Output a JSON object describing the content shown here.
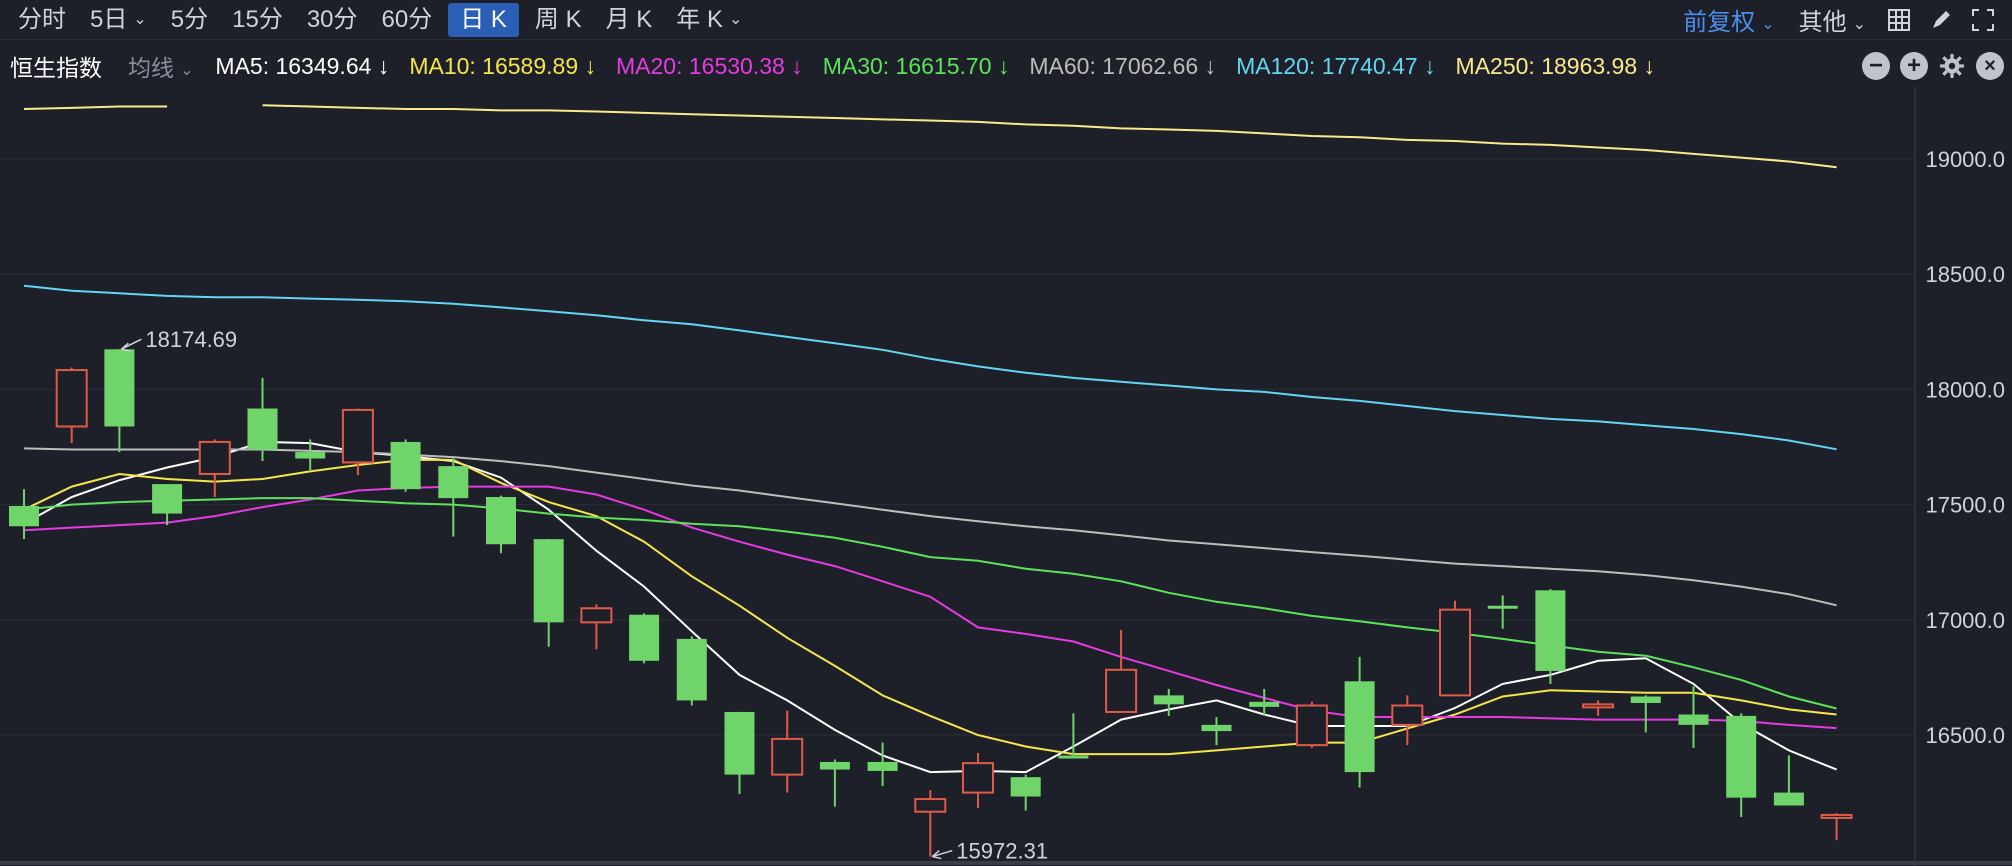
{
  "toolbar": {
    "tabs": [
      {
        "label": "分时",
        "caret": false,
        "active": false
      },
      {
        "label": "5日",
        "caret": true,
        "active": false
      },
      {
        "label": "5分",
        "caret": false,
        "active": false
      },
      {
        "label": "15分",
        "caret": false,
        "active": false
      },
      {
        "label": "30分",
        "caret": false,
        "active": false
      },
      {
        "label": "60分",
        "caret": false,
        "active": false
      },
      {
        "label": "日 K",
        "caret": false,
        "active": true
      },
      {
        "label": "周 K",
        "caret": false,
        "active": false
      },
      {
        "label": "月 K",
        "caret": false,
        "active": false
      },
      {
        "label": "年 K",
        "caret": true,
        "active": false
      }
    ],
    "adjust_label": "前复权",
    "other_label": "其他",
    "icons": [
      "grid-layout-icon",
      "draw-pen-icon",
      "fullscreen-icon"
    ]
  },
  "legend": {
    "index_name": "恒生指数",
    "ma_select": "均线",
    "items": [
      {
        "text": "MA5: 16349.64 ↓",
        "color": "#ffffff"
      },
      {
        "text": "MA10: 16589.89 ↓",
        "color": "#f7e64a"
      },
      {
        "text": "MA20: 16530.38 ↓",
        "color": "#e53be0"
      },
      {
        "text": "MA30: 16615.70 ↓",
        "color": "#5ce35a"
      },
      {
        "text": "MA60: 17062.66 ↓",
        "color": "#bdbdbd"
      },
      {
        "text": "MA120: 17740.47 ↓",
        "color": "#62d6f2"
      },
      {
        "text": "MA250: 18963.98 ↓",
        "color": "#fbea8a"
      }
    ],
    "icons": [
      "zoom-out-icon",
      "zoom-in-icon",
      "settings-icon",
      "close-icon"
    ]
  },
  "chart_data": {
    "type": "candlestick",
    "y_ticks": [
      "19000.0",
      "18500.0",
      "18000.0",
      "17500.0",
      "17000.0",
      "16500.0"
    ],
    "y_tick_values": [
      19000,
      18500,
      18000,
      17500,
      17000,
      16500
    ],
    "ylim": [
      15900,
      19250
    ],
    "up_color": "#e05a4a",
    "down_color": "#6fd46a",
    "candles": [
      {
        "o": 17406,
        "h": 17567,
        "c": 17494,
        "l": 17350,
        "dir": "down"
      },
      {
        "o": 17839,
        "h": 18095,
        "c": 18084,
        "l": 17767,
        "dir": "up"
      },
      {
        "o": 17839,
        "h": 18174.69,
        "c": 18174,
        "l": 17728,
        "dir": "down"
      },
      {
        "o": 17461,
        "h": 17578,
        "c": 17589,
        "l": 17411,
        "dir": "down"
      },
      {
        "o": 17633,
        "h": 17783,
        "c": 17772,
        "l": 17533,
        "dir": "up"
      },
      {
        "o": 17739,
        "h": 18050,
        "c": 17917,
        "l": 17689,
        "dir": "down"
      },
      {
        "o": 17700,
        "h": 17783,
        "c": 17728,
        "l": 17650,
        "dir": "down"
      },
      {
        "o": 17683,
        "h": 17917,
        "c": 17911,
        "l": 17628,
        "dir": "up"
      },
      {
        "o": 17567,
        "h": 17783,
        "c": 17772,
        "l": 17556,
        "dir": "down"
      },
      {
        "o": 17528,
        "h": 17700,
        "c": 17667,
        "l": 17361,
        "dir": "down"
      },
      {
        "o": 17328,
        "h": 17539,
        "c": 17533,
        "l": 17289,
        "dir": "down"
      },
      {
        "o": 16989,
        "h": 17350,
        "c": 17350,
        "l": 16883,
        "dir": "down"
      },
      {
        "o": 16989,
        "h": 17067,
        "c": 17050,
        "l": 16872,
        "dir": "up"
      },
      {
        "o": 16822,
        "h": 17028,
        "c": 17022,
        "l": 16811,
        "dir": "down"
      },
      {
        "o": 16650,
        "h": 16928,
        "c": 16917,
        "l": 16628,
        "dir": "down"
      },
      {
        "o": 16328,
        "h": 16600,
        "c": 16600,
        "l": 16244,
        "dir": "down"
      },
      {
        "o": 16328,
        "h": 16606,
        "c": 16483,
        "l": 16250,
        "dir": "up"
      },
      {
        "o": 16350,
        "h": 16394,
        "c": 16383,
        "l": 16189,
        "dir": "down"
      },
      {
        "o": 16344,
        "h": 16467,
        "c": 16383,
        "l": 16278,
        "dir": "down"
      },
      {
        "o": 16167,
        "h": 16261,
        "c": 16222,
        "l": 15972.31,
        "dir": "up"
      },
      {
        "o": 16250,
        "h": 16422,
        "c": 16378,
        "l": 16183,
        "dir": "up"
      },
      {
        "o": 16233,
        "h": 16328,
        "c": 16317,
        "l": 16172,
        "dir": "down"
      },
      {
        "o": 16411,
        "h": 16594,
        "c": 16411,
        "l": 16411,
        "dir": "down"
      },
      {
        "o": 16600,
        "h": 16956,
        "c": 16783,
        "l": 16600,
        "dir": "up"
      },
      {
        "o": 16633,
        "h": 16700,
        "c": 16672,
        "l": 16583,
        "dir": "down"
      },
      {
        "o": 16517,
        "h": 16578,
        "c": 16544,
        "l": 16456,
        "dir": "down"
      },
      {
        "o": 16622,
        "h": 16700,
        "c": 16644,
        "l": 16583,
        "dir": "down"
      },
      {
        "o": 16456,
        "h": 16644,
        "c": 16628,
        "l": 16444,
        "dir": "up"
      },
      {
        "o": 16339,
        "h": 16839,
        "c": 16733,
        "l": 16272,
        "dir": "down"
      },
      {
        "o": 16544,
        "h": 16672,
        "c": 16628,
        "l": 16456,
        "dir": "up"
      },
      {
        "o": 16672,
        "h": 17083,
        "c": 17044,
        "l": 16672,
        "dir": "up"
      },
      {
        "o": 17061,
        "h": 17106,
        "c": 17050,
        "l": 16961,
        "dir": "down"
      },
      {
        "o": 16778,
        "h": 17133,
        "c": 17128,
        "l": 16722,
        "dir": "down"
      },
      {
        "o": 16633,
        "h": 16650,
        "c": 16628,
        "l": 16583,
        "dir": "up"
      },
      {
        "o": 16667,
        "h": 16672,
        "c": 16639,
        "l": 16511,
        "dir": "down"
      },
      {
        "o": 16544,
        "h": 16711,
        "c": 16589,
        "l": 16444,
        "dir": "down"
      },
      {
        "o": 16228,
        "h": 16594,
        "c": 16583,
        "l": 16144,
        "dir": "down"
      },
      {
        "o": 16194,
        "h": 16411,
        "c": 16250,
        "l": 16194,
        "dir": "down"
      },
      {
        "o": 16153,
        "h": 16161,
        "c": 16150,
        "l": 16044,
        "dir": "up"
      }
    ],
    "annotations": [
      {
        "text": "18174.69",
        "type": "high"
      },
      {
        "text": "15972.31",
        "type": "low"
      }
    ],
    "ma_series": [
      {
        "name": "MA5",
        "color": "#ffffff",
        "values": [
          17417,
          17533,
          17606,
          17661,
          17706,
          17772,
          17767,
          17728,
          17711,
          17689,
          17617,
          17478,
          17300,
          17144,
          16950,
          16761,
          16650,
          16522,
          16411,
          16339,
          16344,
          16339,
          16450,
          16567,
          16611,
          16650,
          16589,
          16539,
          16539,
          16539,
          16617,
          16722,
          16761,
          16822,
          16833,
          16722,
          16550,
          16433,
          16350
        ]
      },
      {
        "name": "MA10",
        "color": "#f7e64a",
        "values": [
          17478,
          17578,
          17633,
          17611,
          17600,
          17611,
          17644,
          17672,
          17694,
          17694,
          17594,
          17511,
          17450,
          17339,
          17189,
          17061,
          16922,
          16800,
          16672,
          16583,
          16500,
          16450,
          16417,
          16417,
          16417,
          16433,
          16450,
          16467,
          16467,
          16528,
          16589,
          16667,
          16694,
          16689,
          16683,
          16683,
          16650,
          16611,
          16589
        ]
      },
      {
        "name": "MA20",
        "color": "#e53be0",
        "values": [
          17389,
          17400,
          17411,
          17422,
          17450,
          17489,
          17522,
          17561,
          17572,
          17578,
          17578,
          17578,
          17544,
          17478,
          17400,
          17339,
          17283,
          17233,
          17167,
          17100,
          16967,
          16939,
          16906,
          16839,
          16778,
          16717,
          16661,
          16606,
          16578,
          16578,
          16578,
          16578,
          16572,
          16567,
          16567,
          16567,
          16561,
          16544,
          16530
        ]
      },
      {
        "name": "MA30",
        "color": "#5ce35a",
        "values": [
          17478,
          17500,
          17511,
          17517,
          17522,
          17528,
          17528,
          17517,
          17506,
          17500,
          17483,
          17461,
          17444,
          17433,
          17417,
          17406,
          17383,
          17356,
          17317,
          17272,
          17256,
          17222,
          17200,
          17167,
          17117,
          17078,
          17050,
          17017,
          16994,
          16967,
          16944,
          16917,
          16889,
          16861,
          16844,
          16794,
          16739,
          16667,
          16615
        ]
      },
      {
        "name": "MA60",
        "color": "#bdbdbd",
        "values": [
          17744,
          17739,
          17739,
          17739,
          17739,
          17739,
          17733,
          17728,
          17717,
          17706,
          17689,
          17667,
          17639,
          17611,
          17583,
          17561,
          17533,
          17506,
          17478,
          17450,
          17428,
          17406,
          17389,
          17367,
          17344,
          17328,
          17311,
          17294,
          17278,
          17261,
          17244,
          17233,
          17222,
          17211,
          17194,
          17172,
          17144,
          17111,
          17063
        ]
      },
      {
        "name": "MA120",
        "color": "#62d6f2",
        "values": [
          18450,
          18428,
          18417,
          18406,
          18400,
          18400,
          18394,
          18389,
          18383,
          18372,
          18356,
          18339,
          18322,
          18300,
          18283,
          18256,
          18228,
          18200,
          18172,
          18133,
          18100,
          18072,
          18050,
          18033,
          18017,
          18000,
          17989,
          17967,
          17950,
          17928,
          17906,
          17889,
          17872,
          17861,
          17844,
          17828,
          17806,
          17778,
          17740
        ]
      },
      {
        "name": "MA250",
        "color": "#fbea8a",
        "values": [
          19217,
          19222,
          19228,
          19228,
          null,
          19233,
          19228,
          19222,
          19217,
          19217,
          19211,
          19211,
          19206,
          19200,
          19194,
          19189,
          19183,
          19178,
          19172,
          19167,
          19161,
          19150,
          19144,
          19133,
          19128,
          19122,
          19111,
          19100,
          19094,
          19083,
          19078,
          19067,
          19061,
          19050,
          19039,
          19022,
          19006,
          18989,
          18964
        ]
      }
    ]
  }
}
